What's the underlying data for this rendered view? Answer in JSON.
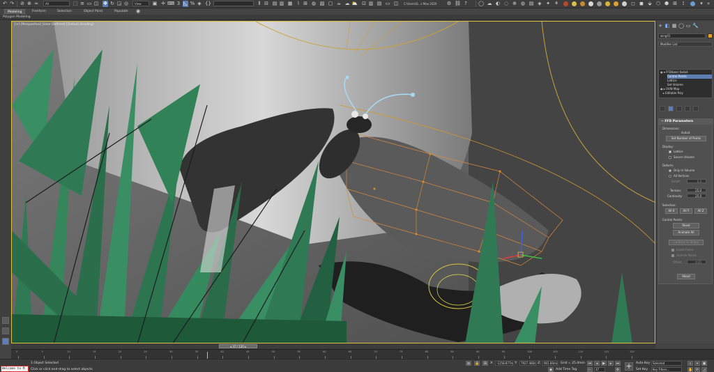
{
  "toolbar": {
    "selection_filter": "All",
    "view_ref": "View",
    "selection_set": "",
    "project_path": "C:\\Users\\S...s Max 2020",
    "colors": {
      "accent": "#5d7fb3",
      "active_frame": "#e0c040"
    }
  },
  "ribbon": {
    "tabs": [
      "Modeling",
      "Freeform",
      "Selection",
      "Object Paint",
      "Populate"
    ],
    "active_tab": "Modeling",
    "subpanel": "Polygon Modeling"
  },
  "viewport": {
    "label": "[+] [Perspective] [User Defined] [Default Shading]"
  },
  "command_panel": {
    "object_name": "wing01",
    "modifier_list": "Modifier List",
    "stack": [
      {
        "label": "FFD(box) 4x4x4",
        "indent": 0
      },
      {
        "label": "Control Points",
        "indent": 1
      },
      {
        "label": "Lattice",
        "indent": 1
      },
      {
        "label": "Set Volume",
        "indent": 1
      },
      {
        "label": "UVW Map",
        "indent": 0
      },
      {
        "label": "Editable Poly",
        "indent": 0
      }
    ],
    "selected_stack_index": 1,
    "rollout": {
      "title": "FFD Parameters",
      "dimensions_label": "Dimensions:",
      "dimensions_value": "4x4x4",
      "set_points_btn": "Set Number of Points",
      "display_label": "Display:",
      "lattice_label": "Lattice",
      "source_volume_label": "Source Volume",
      "deform_label": "Deform:",
      "only_in_volume": "Only In Volume",
      "all_vertices": "All Vertices",
      "falloff_label": "Falloff:",
      "falloff_value": "0.0",
      "tension_label": "Tension:",
      "tension_value": "25.0",
      "continuity_label": "Continuity:",
      "continuity_value": "25.0",
      "selection_label": "Selection:",
      "all_x": "All X",
      "all_y": "All Y",
      "all_z": "All Z",
      "control_points_label": "Control Points:",
      "reset_btn": "Reset",
      "animate_all_btn": "Animate All",
      "conform_btn": "Conform to Shape",
      "inside_points": "Inside Points",
      "outside_points": "Outside Points",
      "offset_label": "Offset:",
      "offset_value": "0.05",
      "about_btn": "About"
    }
  },
  "timeline": {
    "frame_display": "37 / 120",
    "ticks": [
      "0",
      "5",
      "10",
      "15",
      "20",
      "25",
      "30",
      "35",
      "40",
      "45",
      "50",
      "55",
      "60",
      "65",
      "70",
      "75",
      "80",
      "85",
      "90",
      "95",
      "100",
      "105",
      "110",
      "115",
      "120"
    ]
  },
  "status": {
    "maxscript": "Welcome to M",
    "selected": "1 Object Selected",
    "prompt": "Click or click-and-drag to select objects",
    "x_value": "-1258.877mm",
    "y_value": "7927.466mm",
    "z_value": "901.80mm",
    "grid": "Grid = 25.4mm",
    "add_time_tag": "Add Time Tag",
    "auto_key": "Auto Key",
    "set_key": "Set Key",
    "key_mode": "Selected",
    "key_filters": "Key Filters...",
    "current_frame": "37"
  }
}
